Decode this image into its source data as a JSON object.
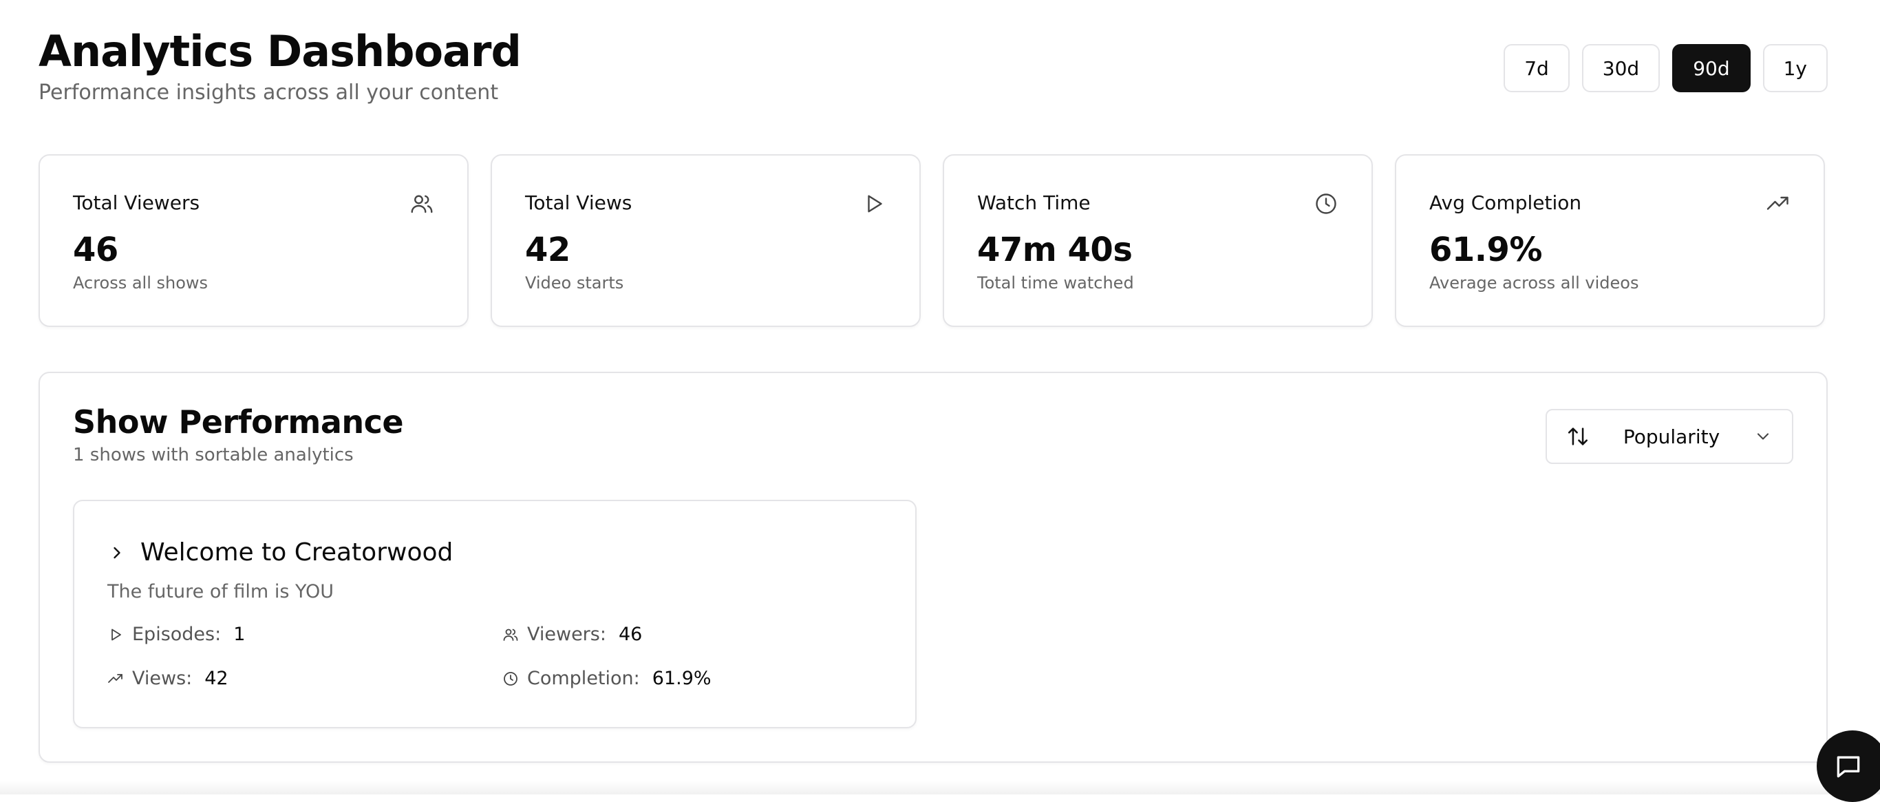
{
  "header": {
    "title": "Analytics Dashboard",
    "subtitle": "Performance insights across all your content"
  },
  "time_range": {
    "options": [
      "7d",
      "30d",
      "90d",
      "1y"
    ],
    "selected": "90d"
  },
  "stats": [
    {
      "label": "Total Viewers",
      "value": "46",
      "sub": "Across all shows",
      "icon": "users-icon"
    },
    {
      "label": "Total Views",
      "value": "42",
      "sub": "Video starts",
      "icon": "play-icon"
    },
    {
      "label": "Watch Time",
      "value": "47m 40s",
      "sub": "Total time watched",
      "icon": "clock-icon"
    },
    {
      "label": "Avg Completion",
      "value": "61.9%",
      "sub": "Average across all videos",
      "icon": "trending-up-icon"
    }
  ],
  "performance": {
    "title": "Show Performance",
    "subtitle": "1 shows with sortable analytics",
    "sort": {
      "selected": "Popularity",
      "icon": "sort-arrows-icon"
    },
    "shows": [
      {
        "title": "Welcome to Creatorwood",
        "description": "The future of film is YOU",
        "episodes_label": "Episodes:",
        "episodes": "1",
        "viewers_label": "Viewers:",
        "viewers": "46",
        "views_label": "Views:",
        "views": "42",
        "completion_label": "Completion:",
        "completion": "61.9%"
      }
    ]
  },
  "colors": {
    "accent": "#111111",
    "border": "#e4e4e7",
    "muted_text": "#666666"
  }
}
